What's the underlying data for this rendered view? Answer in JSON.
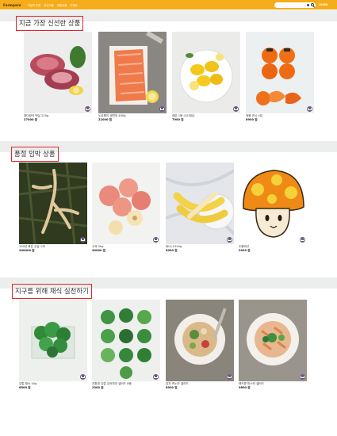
{
  "header": {
    "logo": "Farmpare",
    "nav": [
      "오늘의 추천",
      "신선식품",
      "제철상품",
      "이벤트"
    ],
    "login": "LOGIN"
  },
  "colors": {
    "brand": "#f5ad1b",
    "highlight_border": "#e2242a",
    "cart_button": "#6d5a7e"
  },
  "sections": [
    {
      "title": "지금 가장 신선한 상품",
      "products": [
        {
          "name": "참다랑어 뱃살 220g",
          "price": "27000 원",
          "desc": "",
          "image": "tuna"
        },
        {
          "name": "노르웨이 생연어 400g",
          "price": "21000 원",
          "desc": "",
          "image": "salmon"
        },
        {
          "name": "레몬 1봉 (10개입)",
          "price": "7900 원",
          "desc": "",
          "image": "lemons"
        },
        {
          "name": "대봉 연시 4입",
          "price": "8900 원",
          "desc": "",
          "image": "persimmons"
        }
      ]
    },
    {
      "title": "품절 임박 상품",
      "products": [
        {
          "name": "100년 묵은 산삼 1개",
          "price": "200000 원",
          "desc": "",
          "image": "ginseng"
        },
        {
          "name": "사과 5kg",
          "price": "30000 원",
          "desc": "",
          "image": "apples"
        },
        {
          "name": "바나나 500g",
          "price": "5000 원",
          "desc": "",
          "image": "bananas"
        },
        {
          "name": "주황버섯",
          "price": "9999 원",
          "desc": "",
          "image": "mushroom"
        }
      ]
    },
    {
      "title": "지구를 위해 채식 실천하기",
      "products": [
        {
          "name": "유럽 채소 40g",
          "price": "6500 원",
          "desc": "",
          "image": "greens"
        },
        {
          "name": "친환경 유럽 유러피안 샐러드 8종",
          "price": "2300 원",
          "desc": "",
          "image": "saladbowls"
        },
        {
          "name": "감자 퀴노아 샐러드",
          "price": "6900 원",
          "desc": "",
          "image": "quinoa"
        },
        {
          "name": "렌즈콩 파스타 샐러드",
          "price": "9800 원",
          "desc": "",
          "image": "pasta"
        }
      ]
    }
  ]
}
